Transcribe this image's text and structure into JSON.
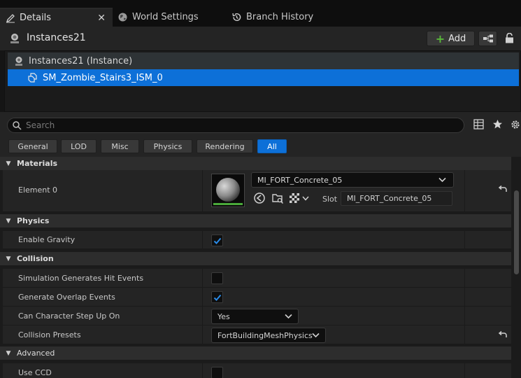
{
  "tabs": [
    {
      "label": "Details",
      "icon": "pencil-icon"
    },
    {
      "label": "World Settings",
      "icon": "globe-icon"
    },
    {
      "label": "Branch History",
      "icon": "history-icon"
    }
  ],
  "header": {
    "title": "Instances21",
    "add_label": "Add"
  },
  "tree": {
    "root_label": "Instances21 (Instance)",
    "selected_label": "SM_Zombie_Stairs3_ISM_0"
  },
  "search": {
    "placeholder": "Search"
  },
  "filters": [
    "General",
    "LOD",
    "Misc",
    "Physics",
    "Rendering",
    "All"
  ],
  "active_filter": "All",
  "sections": {
    "materials": {
      "title": "Materials",
      "element_label": "Element 0",
      "material_name": "MI_FORT_Concrete_05",
      "slot_label": "Slot",
      "slot_value": "MI_FORT_Concrete_05"
    },
    "physics": {
      "title": "Physics",
      "enable_gravity_label": "Enable Gravity",
      "enable_gravity": true
    },
    "collision": {
      "title": "Collision",
      "sim_hit_label": "Simulation Generates Hit Events",
      "sim_hit": false,
      "overlap_label": "Generate Overlap Events",
      "overlap": true,
      "step_up_label": "Can Character Step Up On",
      "step_up_value": "Yes",
      "presets_label": "Collision Presets",
      "presets_value": "FortBuildingMeshPhysics"
    },
    "advanced": {
      "title": "Advanced",
      "use_ccd_label": "Use CCD",
      "use_ccd": false
    }
  },
  "colors": {
    "accent": "#0d70d8",
    "add_plus": "#59b83a",
    "background": "#151515"
  }
}
